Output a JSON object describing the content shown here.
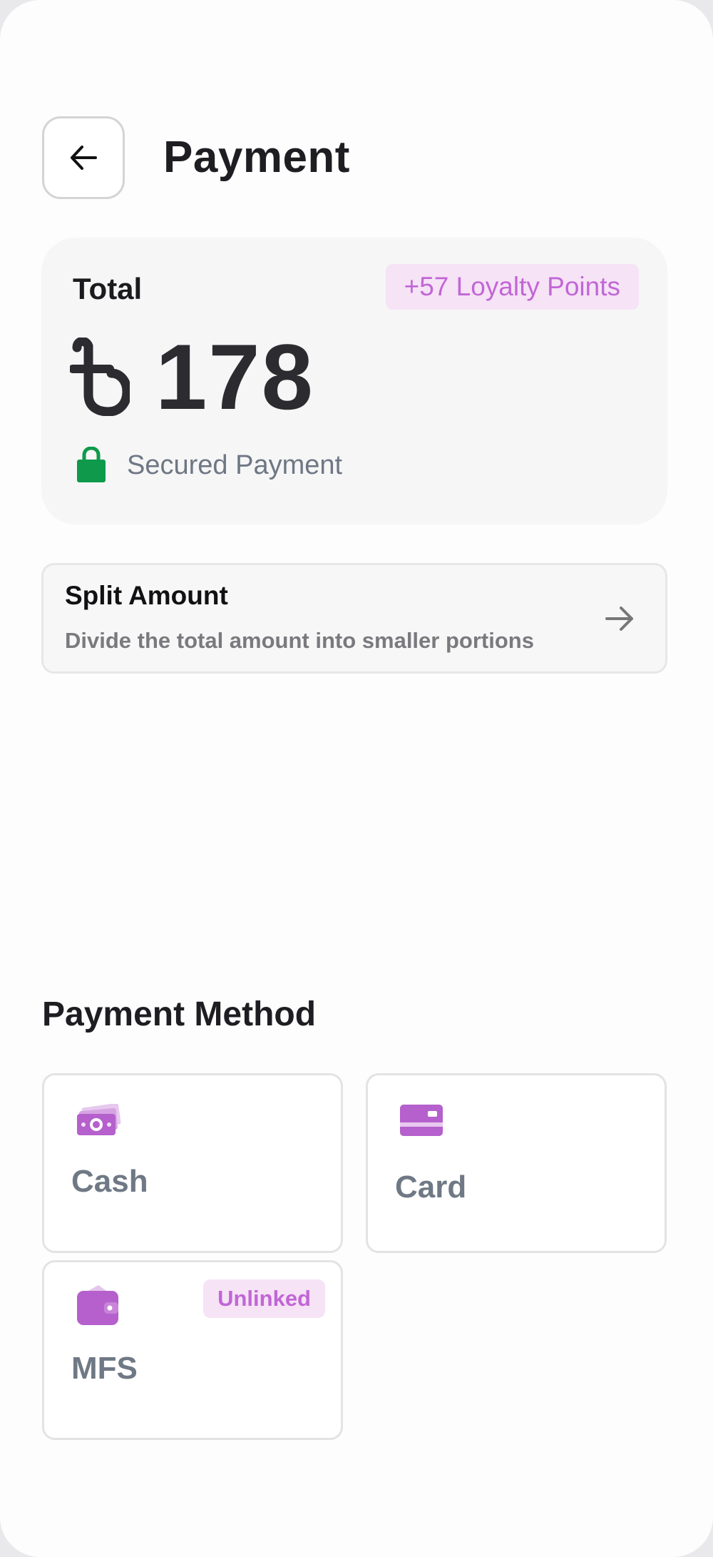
{
  "header": {
    "title": "Payment",
    "back_icon": "arrow-left-icon"
  },
  "total": {
    "label": "Total",
    "loyalty_badge": "+57 Loyalty Points",
    "currency_icon": "taka-icon",
    "amount": "178",
    "secured_icon": "lock-icon",
    "secured_text": "Secured Payment"
  },
  "split": {
    "title": "Split Amount",
    "subtitle": "Divide the total amount into smaller portions",
    "arrow_icon": "arrow-right-icon"
  },
  "payment_method": {
    "title": "Payment Method",
    "methods": [
      {
        "label": "Cash",
        "icon": "cash-icon"
      },
      {
        "label": "Card",
        "icon": "card-icon"
      },
      {
        "label": "MFS",
        "icon": "wallet-icon",
        "badge": "Unlinked"
      }
    ]
  },
  "colors": {
    "accent": "#c166d6",
    "accent_bg": "#f6e3f6",
    "secure_green": "#0e9a4a",
    "label_gray": "#6f7985"
  }
}
